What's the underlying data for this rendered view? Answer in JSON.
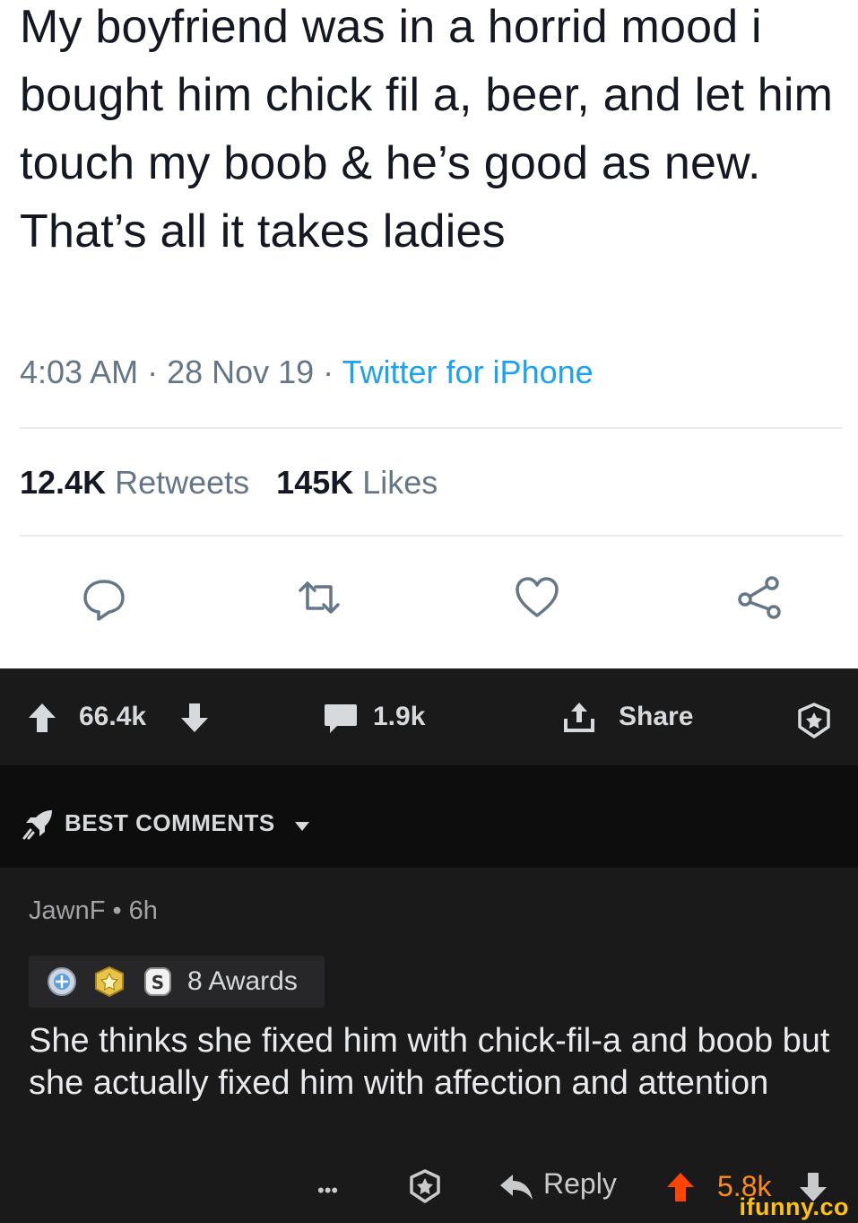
{
  "tweet": {
    "text": "My boyfriend was in a horrid mood i bought him chick fil a, beer, and let him touch my boob & he’s good as new. That’s all it takes ladies",
    "time": "4:03 AM · 28 Nov 19 · ",
    "source": "Twitter for iPhone",
    "retweets_count": "12.4K",
    "retweets_label": "Retweets",
    "likes_count": "145K",
    "likes_label": "Likes",
    "accent_color": "#1da1f2"
  },
  "post_bar": {
    "upvotes": "66.4k",
    "comments": "1.9k",
    "share_label": "Share"
  },
  "sort": {
    "label": "BEST COMMENTS"
  },
  "comment": {
    "meta": "JawnF • 6h",
    "awards_label": "8 Awards",
    "body": "She thinks she fixed him with chick-fil-a and boob but she actually fixed him with affection and attention",
    "more_label": "•••",
    "reply_label": "Reply",
    "score": "5.8k",
    "upvote_color": "#ff4500",
    "score_color": "#ff8c1a"
  },
  "watermark": "ifunny.co"
}
